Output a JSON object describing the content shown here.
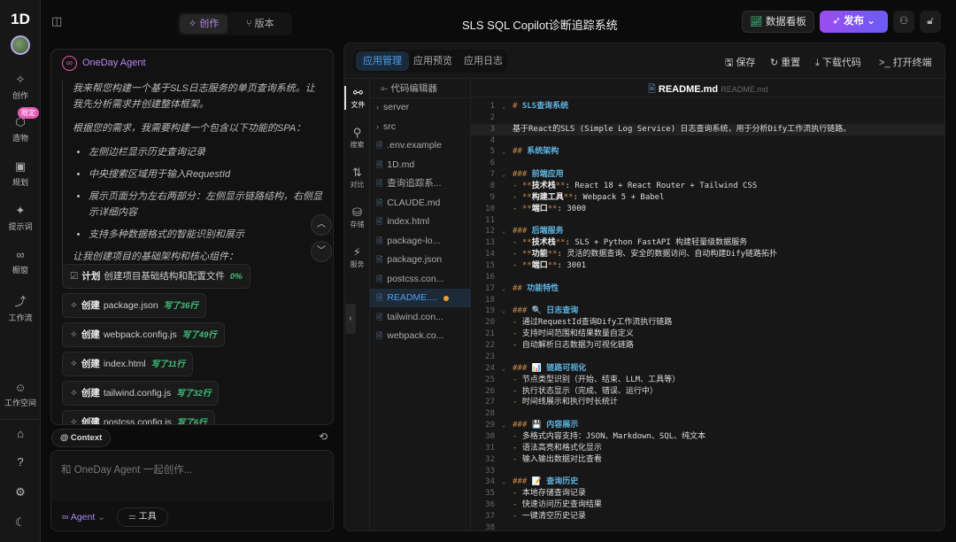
{
  "rail": {
    "logo": "1D",
    "badge": "限定",
    "items": [
      {
        "icon": "wand-icon",
        "label": "创作",
        "glyph": "✧"
      },
      {
        "icon": "cube-icon",
        "label": "造物",
        "glyph": "⬡"
      },
      {
        "icon": "calendar-icon",
        "label": "规划",
        "glyph": "▣"
      },
      {
        "icon": "sparkle-icon",
        "label": "提示词",
        "glyph": "✦"
      },
      {
        "icon": "binoculars-icon",
        "label": "橱窗",
        "glyph": "∞"
      },
      {
        "icon": "workflow-icon",
        "label": "工作流",
        "glyph": "⤴"
      },
      {
        "icon": "team-icon",
        "label": "工作空间",
        "glyph": "☺"
      }
    ],
    "bottom": [
      {
        "icon": "home-icon",
        "glyph": "⌂"
      },
      {
        "icon": "help-icon",
        "glyph": "?"
      },
      {
        "icon": "settings-icon",
        "glyph": "⚙"
      },
      {
        "icon": "moon-icon",
        "glyph": "☾"
      }
    ]
  },
  "topbar": {
    "tabs": [
      {
        "label": "创作",
        "active": true
      },
      {
        "label": "版本",
        "active": false
      }
    ],
    "title": "SLS SQL Copilot诊断追踪系统",
    "dashboard": "数据看板",
    "publish": "发布",
    "accent": "#8b5cf6"
  },
  "chat": {
    "agent": "OneDay Agent",
    "paragraphs": [
      "我来帮您构建一个基于SLS日志服务的单页查询系统。让我先分析需求并创建整体框架。",
      "根据您的需求，我需要构建一个包含以下功能的SPA："
    ],
    "bullets": [
      "左侧边栏显示历史查询记录",
      "中央搜索区域用于输入RequestId",
      "展示页面分为左右两部分：左侧显示链路结构，右侧显示详细内容",
      "支持多种数据格式的智能识别和展示"
    ],
    "closing": "让我创建项目的基础架构和核心组件：",
    "steps": [
      {
        "verb": "计划",
        "file": "创建项目基础结构和配置文件",
        "progress": "0%"
      },
      {
        "verb": "创建",
        "file": "package.json",
        "progress": "写了36行"
      },
      {
        "verb": "创建",
        "file": "webpack.config.js",
        "progress": "写了49行"
      },
      {
        "verb": "创建",
        "file": "index.html",
        "progress": "写了11行"
      },
      {
        "verb": "创建",
        "file": "tailwind.config.js",
        "progress": "写了32行"
      },
      {
        "verb": "创建",
        "file": "postcss.config.js",
        "progress": "写了6行"
      }
    ],
    "context": "@ Context",
    "placeholder": "和 OneDay Agent 一起创作...",
    "mode": "Agent",
    "tools": "工具"
  },
  "app": {
    "tabs": [
      "应用管理",
      "应用预览",
      "应用日志"
    ],
    "actions": [
      "保存",
      "重置",
      "下载代码",
      "打开终端"
    ],
    "activity": [
      "文件",
      "搜索",
      "对比",
      "存储",
      "服务"
    ],
    "tree_title": "代码编辑器",
    "files": [
      {
        "name": "server",
        "type": "folder"
      },
      {
        "name": "src",
        "type": "folder"
      },
      {
        "name": ".env.example",
        "type": "file"
      },
      {
        "name": "1D.md",
        "type": "file"
      },
      {
        "name": "查询追踪系...",
        "type": "file"
      },
      {
        "name": "CLAUDE.md",
        "type": "file"
      },
      {
        "name": "index.html",
        "type": "file"
      },
      {
        "name": "package-lo...",
        "type": "file"
      },
      {
        "name": "package.json",
        "type": "file"
      },
      {
        "name": "postcss.con...",
        "type": "file"
      },
      {
        "name": "README....",
        "type": "file",
        "selected": true,
        "modified": true
      },
      {
        "name": "tailwind.con...",
        "type": "file"
      },
      {
        "name": "webpack.co...",
        "type": "file"
      }
    ],
    "editor_file": "README.md",
    "editor_path": "README.md",
    "lines": [
      "# SLS查询系统",
      "",
      "基于React的SLS (Simple Log Service) 日志查询系统，用于分析Dify工作流执行链路。",
      "",
      "## 系统架构",
      "",
      "### 前端应用",
      "- **技术栈**: React 18 + React Router + Tailwind CSS",
      "- **构建工具**: Webpack 5 + Babel",
      "- **端口**: 3000",
      "",
      "### 后端服务",
      "- **技术栈**: SLS + Python FastAPI 构建轻量级数据服务",
      "- **功能**: 灵活的数据查询、安全的数据访问、自动构建Dify链路拓扑",
      "- **端口**: 3001",
      "",
      "## 功能特性",
      "",
      "### 🔍 日志查询",
      "- 通过RequestId查询Dify工作流执行链路",
      "- 支持时间范围和结果数量自定义",
      "- 自动解析日志数据为可视化链路",
      "",
      "### 📊 链路可视化",
      "- 节点类型识别（开始、结束、LLM、工具等）",
      "- 执行状态显示（完成、错误、运行中）",
      "- 时间线展示和执行时长统计",
      "",
      "### 💾 内容展示",
      "- 多格式内容支持：JSON、Markdown、SQL、纯文本",
      "- 语法高亮和格式化显示",
      "- 输入输出数据对比查看",
      "",
      "### 📝 查询历史",
      "- 本地存储查询记录",
      "- 快速访问历史查询结果",
      "- 一键清空历史记录",
      ""
    ]
  }
}
